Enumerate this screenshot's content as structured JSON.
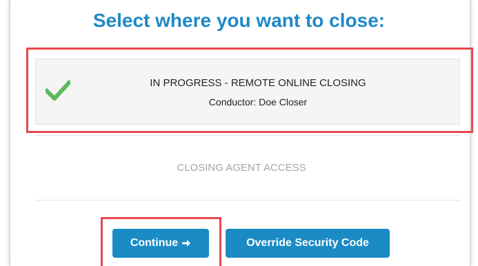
{
  "dialog": {
    "title": "Select where you want to close:"
  },
  "option": {
    "status": "IN PROGRESS - REMOTE ONLINE CLOSING",
    "conductor": "Conductor: Doe Closer",
    "selected": true,
    "icon": "check-icon"
  },
  "agent_access": {
    "label": "CLOSING AGENT ACCESS"
  },
  "buttons": {
    "continue_label": "Continue",
    "continue_icon": "arrow-right-icon",
    "override_label": "Override Security Code"
  },
  "colors": {
    "title": "#1e88c7",
    "button": "#1a8bc5",
    "check": "#5cb85c",
    "highlight": "#e8474c",
    "muted_text": "#a6a6a6"
  }
}
